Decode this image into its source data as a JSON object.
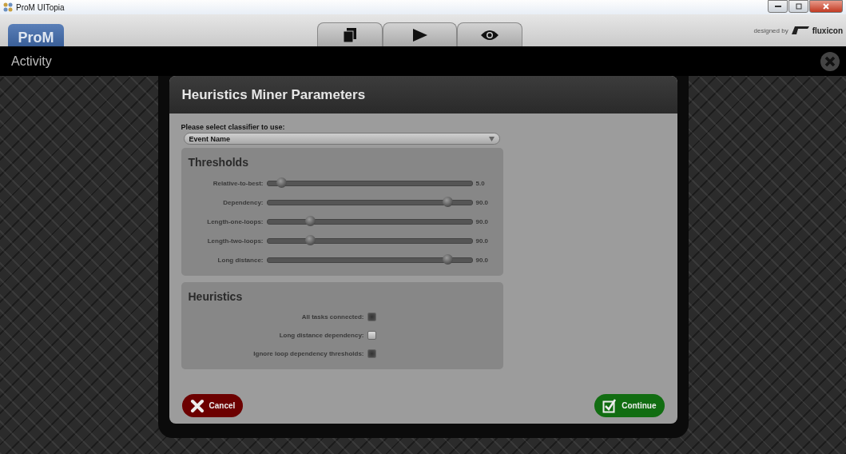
{
  "window": {
    "title": "ProM UITopia"
  },
  "header": {
    "logo": "ProM",
    "credit": "designed by",
    "brand": "fluxicon"
  },
  "activity_bar": {
    "title": "Activity"
  },
  "dialog": {
    "title": "Heuristics Miner Parameters",
    "classifier": {
      "label": "Please select classifier to use:",
      "value": "Event Name"
    },
    "thresholds": {
      "title": "Thresholds",
      "sliders": [
        {
          "label": "Relative-to-best:",
          "level": 0.07,
          "reading": "5.0"
        },
        {
          "label": "Dependency:",
          "level": 0.88,
          "reading": "90.0"
        },
        {
          "label": "Length-one-loops:",
          "level": 0.21,
          "reading": "90.0"
        },
        {
          "label": "Length-two-loops:",
          "level": 0.21,
          "reading": "90.0"
        },
        {
          "label": "Long distance:",
          "level": 0.88,
          "reading": "90.0"
        }
      ]
    },
    "heuristics": {
      "title": "Heuristics",
      "options": [
        {
          "label": "All tasks connected:",
          "checked": true
        },
        {
          "label": "Long distance dependency:",
          "checked": false
        },
        {
          "label": "Ignore loop dependency thresholds:",
          "checked": true
        }
      ]
    },
    "buttons": [
      {
        "kind": "cancel",
        "label": "Cancel"
      },
      {
        "kind": "continue",
        "label": "Continue"
      }
    ]
  }
}
